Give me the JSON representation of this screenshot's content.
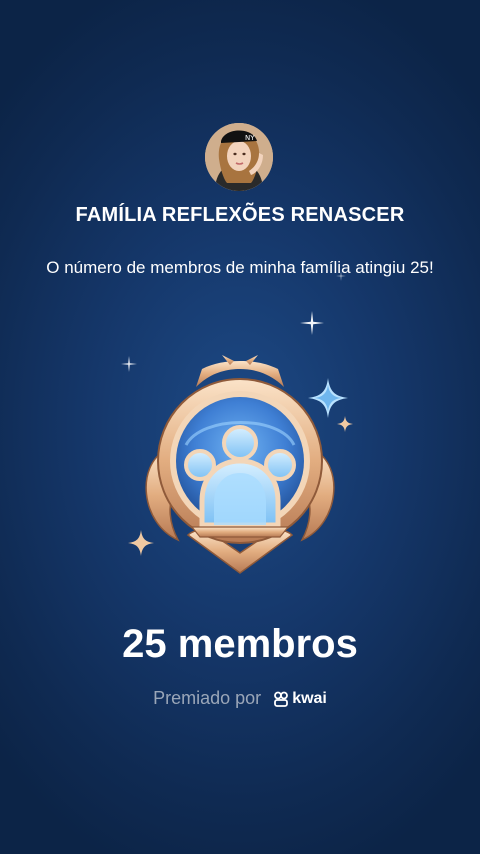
{
  "family": {
    "name": "FAMÍLIA REFLEXÕES RENASCER",
    "message": "O número de membros de minha família atingiu 25!"
  },
  "achievement": {
    "count_label": "25 membros",
    "badge_icon": "family-members-badge-icon"
  },
  "footer": {
    "awarded_by": "Premiado por",
    "brand": "kwai"
  },
  "colors": {
    "background": "#15376a",
    "badge_gold": "#e8b98f",
    "badge_blue": "#4f8fe0",
    "muted_text": "#9aa6b8"
  }
}
